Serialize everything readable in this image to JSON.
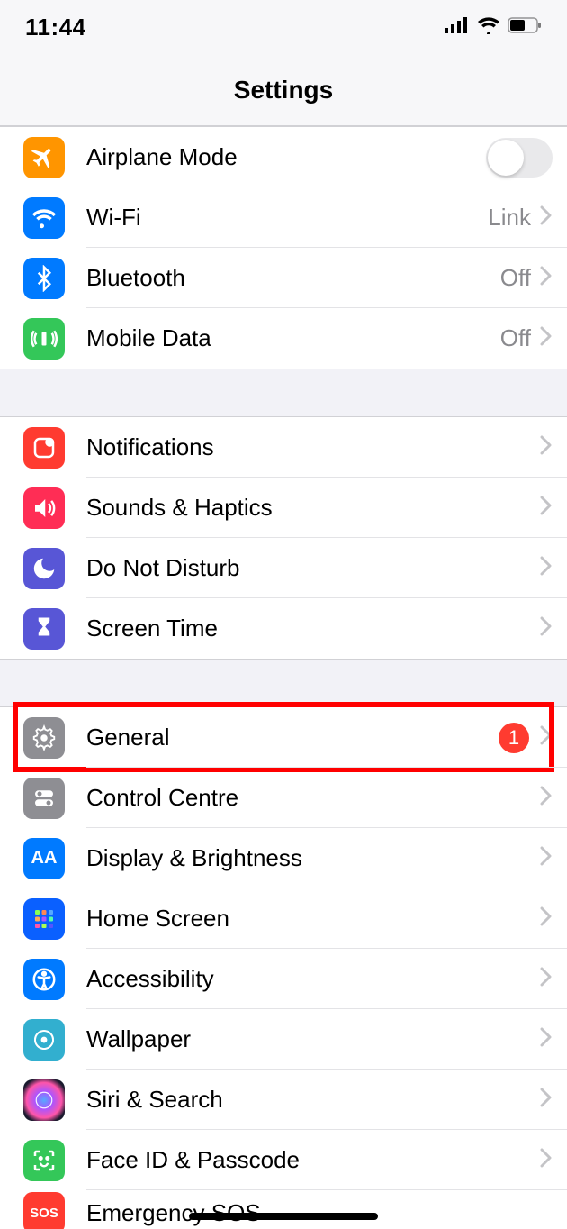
{
  "statusbar": {
    "time": "11:44"
  },
  "header": {
    "title": "Settings"
  },
  "group1": {
    "airplane": {
      "label": "Airplane Mode",
      "on": false
    },
    "wifi": {
      "label": "Wi-Fi",
      "value": "Link"
    },
    "bluetooth": {
      "label": "Bluetooth",
      "value": "Off"
    },
    "mobiledata": {
      "label": "Mobile Data",
      "value": "Off"
    }
  },
  "group2": {
    "notifications": {
      "label": "Notifications"
    },
    "sounds": {
      "label": "Sounds & Haptics"
    },
    "dnd": {
      "label": "Do Not Disturb"
    },
    "screentime": {
      "label": "Screen Time"
    }
  },
  "group3": {
    "general": {
      "label": "General",
      "badge": "1",
      "highlighted": true
    },
    "controlcentre": {
      "label": "Control Centre"
    },
    "display": {
      "label": "Display & Brightness"
    },
    "homescreen": {
      "label": "Home Screen"
    },
    "accessibility": {
      "label": "Accessibility"
    },
    "wallpaper": {
      "label": "Wallpaper"
    },
    "siri": {
      "label": "Siri & Search"
    },
    "faceid": {
      "label": "Face ID & Passcode"
    },
    "sos": {
      "label": "Emergency SOS"
    }
  }
}
